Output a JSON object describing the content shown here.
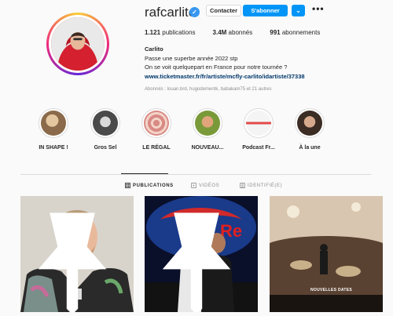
{
  "profile": {
    "username": "rafcarlito",
    "contact_label": "Contacter",
    "follow_label": "S'abonner",
    "chevron": "⌄",
    "more": "•••",
    "publications_count": "1.121",
    "publications_label": "publications",
    "followers_count": "3.4M",
    "followers_label": "abonnés",
    "following_count": "991",
    "following_label": "abonnements",
    "name": "Carlito",
    "bio_line1": "Passe une superbe année 2022 stp",
    "bio_line2": "On se voit quelquepart en France pour notre tournée ?",
    "link": "www.ticketmaster.fr/fr/artiste/mcfly-carlito/idartiste/37338",
    "followed_by": "Abonnés : louan.brd, hugodementk, babakam75 et 21 autres"
  },
  "highlights": [
    {
      "label": "IN SHAPE !",
      "icon": "highlight-in-shape",
      "color": "#8a6a4a"
    },
    {
      "label": "Gros Sel",
      "icon": "highlight-gros-sel",
      "color": "#4a4a4a"
    },
    {
      "label": "LE RÉGAL",
      "icon": "highlight-le-regal",
      "color": "#c0706a"
    },
    {
      "label": "NOUVEAU...",
      "icon": "highlight-nouveau",
      "color": "#c8875a"
    },
    {
      "label": "Podcast Fr...",
      "icon": "highlight-podcast",
      "color": "#e8e0e0"
    },
    {
      "label": "À la une",
      "icon": "highlight-a-la-une",
      "color": "#9a6a50"
    }
  ],
  "tabs": [
    {
      "label": "PUBLICATIONS",
      "icon": "grid-icon",
      "active": true
    },
    {
      "label": "VIDÉOS",
      "icon": "video-icon",
      "active": false
    },
    {
      "label": "IDENTIFIÉ(E)",
      "icon": "tagged-icon",
      "active": false
    }
  ],
  "posts": [
    {
      "name": "post-1",
      "pinned": true
    },
    {
      "name": "post-2",
      "pinned": true
    },
    {
      "name": "post-3",
      "pinned": false,
      "caption": "NOUVELLES DATES"
    }
  ],
  "colors": {
    "accent": "#0095f6",
    "link": "#00376b",
    "muted": "#8e8e8e"
  }
}
